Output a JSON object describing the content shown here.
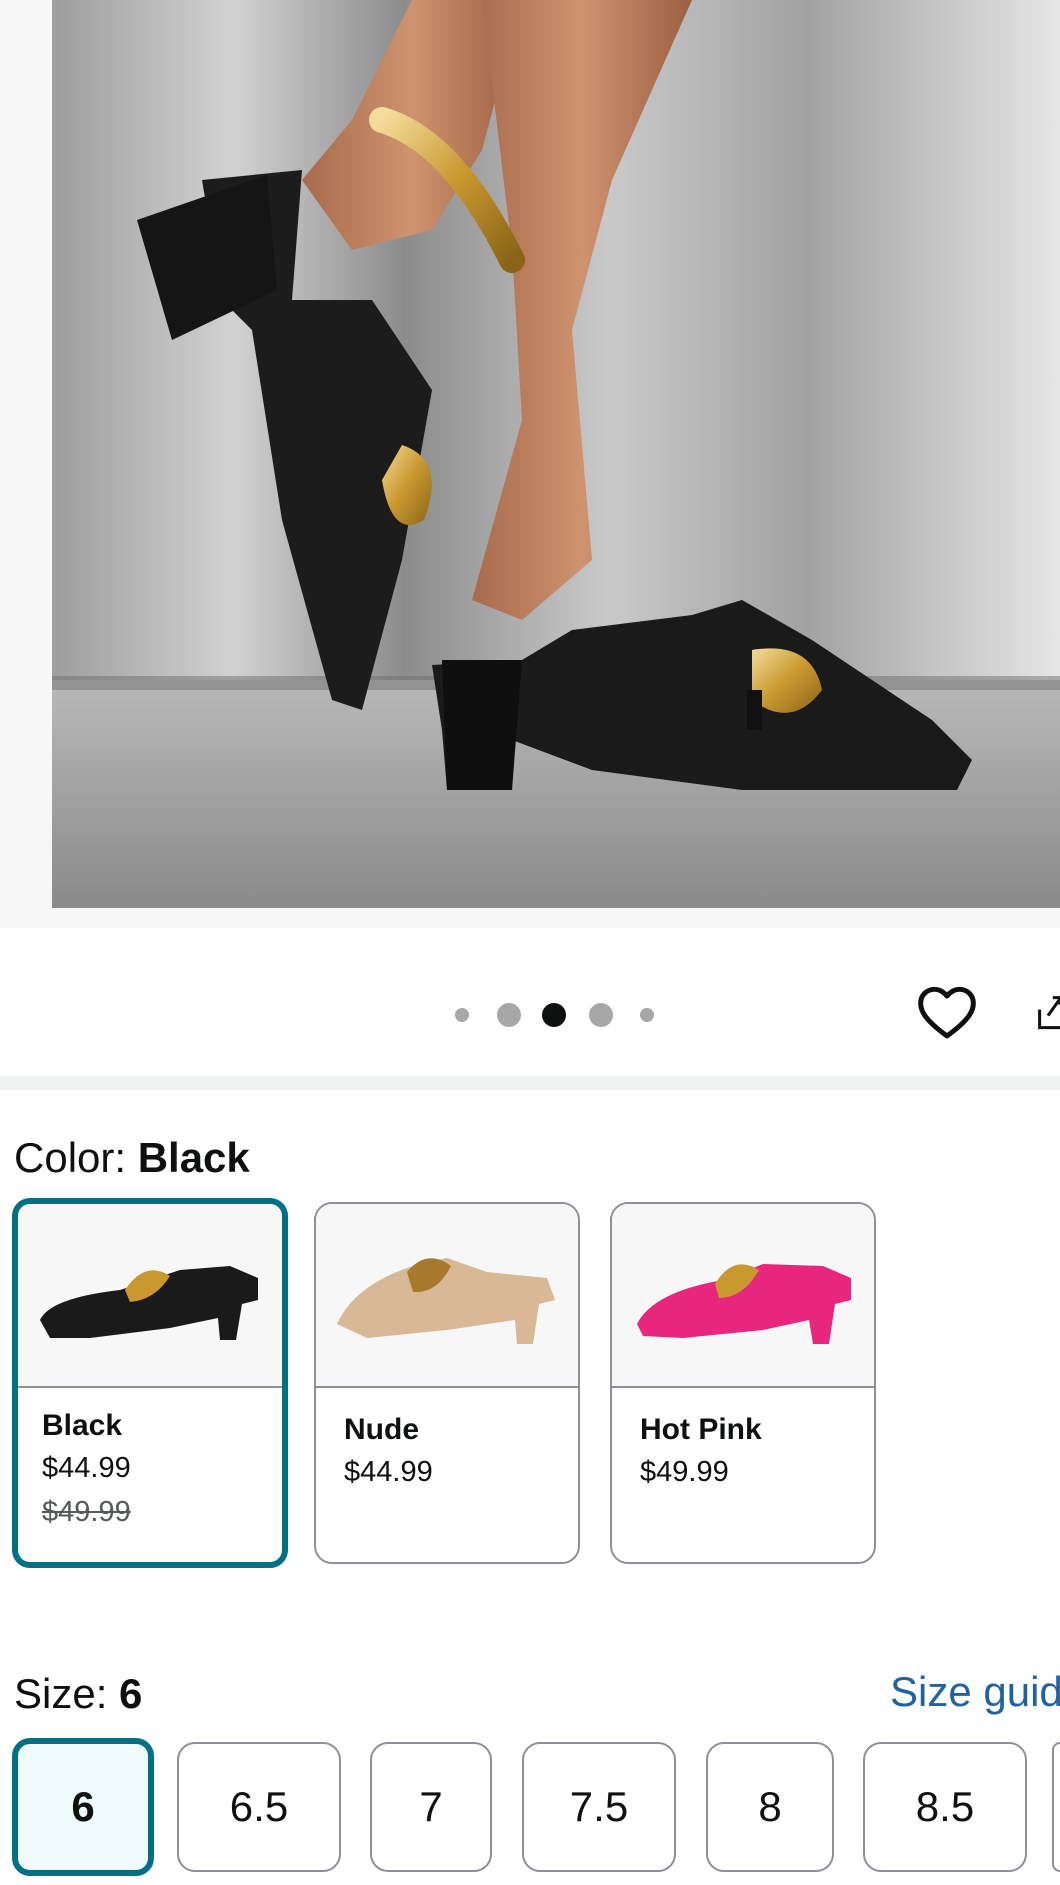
{
  "gallery": {
    "image_alt": "Woman wearing black knit pointed-toe block heel mules with gold chain",
    "image_count": 5,
    "active_index": 2
  },
  "actions": {
    "favorite_icon": "heart-icon",
    "share_icon": "share-icon"
  },
  "color": {
    "label": "Color: ",
    "selected": "Black",
    "options": [
      {
        "name": "Black",
        "price": "$44.99",
        "list_price": "$49.99",
        "shoe_color": "#1a1a1a",
        "selected": true
      },
      {
        "name": "Nude",
        "price": "$44.99",
        "list_price": "",
        "shoe_color": "#d9b896",
        "selected": false
      },
      {
        "name": "Hot Pink",
        "price": "$49.99",
        "list_price": "",
        "shoe_color": "#e9267e",
        "selected": false
      }
    ]
  },
  "size": {
    "label": "Size: ",
    "selected": "6",
    "guide_label": "Size guide",
    "options": [
      "6",
      "6.5",
      "7",
      "7.5",
      "8",
      "8.5"
    ]
  },
  "colors": {
    "accent": "#007185",
    "link": "#2162a1",
    "selected_bg": "#effbfd",
    "border": "#8d9096"
  }
}
